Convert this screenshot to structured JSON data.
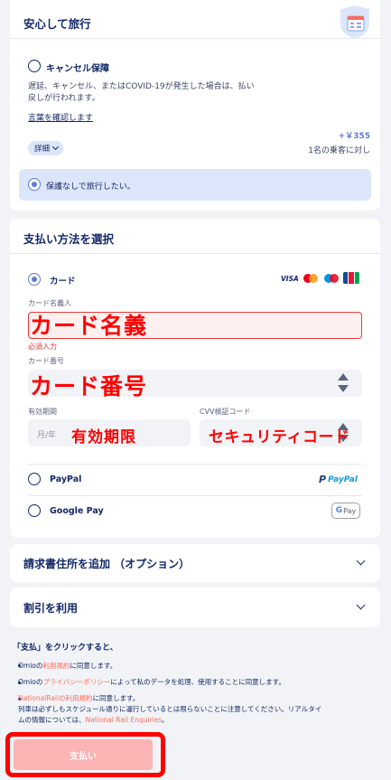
{
  "insurance": {
    "title": "安心して旅行",
    "option_title": "キャンセル保障",
    "option_desc_line1": "遅延、キャンセル、またはCOVID-19が発生した場合は、払い",
    "option_desc_line2": "戻しが行われます。",
    "terms_link": "言葉を確認します",
    "price": "+￥355",
    "per_passenger": "1名の乗客に対し",
    "details_badge": "詳細",
    "no_insurance": "保護なしで旅行したい。"
  },
  "payment": {
    "title": "支払い方法を選択",
    "card_label": "カード",
    "card_brands": [
      "VISA",
      "mastercard",
      "maestro",
      "JCB"
    ],
    "name_label": "カード名義人",
    "name_annotation": "カード名義",
    "required": "必須入力",
    "number_label": "カード番号",
    "number_annotation": "カード番号",
    "expiry_label": "有効期間",
    "expiry_placeholder": "月/年",
    "expiry_annotation": "有効期限",
    "cvv_label": "CVV検証コード",
    "cvv_annotation": "セキュリティコード",
    "paypal_label": "PayPal",
    "paypal_logo": "PayPal",
    "gpay_label": "Google Pay",
    "gpay_logo": "Pay"
  },
  "billing": {
    "title": "請求書住所を追加 （オプション）"
  },
  "discount": {
    "title": "割引を利用"
  },
  "consent": {
    "intro": "「支払」をクリックすると、",
    "item1_prefix": "Omioの",
    "item1_link": "利用規約",
    "item1_suffix": "に同意します。",
    "item2_prefix": "Omioの",
    "item2_link": "プライバシーポリシー",
    "item2_suffix": "によって私のデータを処理、使用することに同意します。",
    "item3_link": "NationalRailの利用規約",
    "item3_suffix": "に同意します。",
    "item3_line2": "列車は必ずしもスケジュール通りに運行しているとは限らないことに注意してください。リアルタイ",
    "item3_line3_prefix": "ムの情報については、",
    "item3_line3_link": "National Rail Enquiries",
    "item3_line3_suffix": "。"
  },
  "pay_button": "支払い",
  "colors": {
    "primary": "#132968",
    "accent": "#5f7bd6",
    "link": "#ff6b5b",
    "annotation": "#ff0000",
    "pay_button": "#fbb3b3"
  }
}
